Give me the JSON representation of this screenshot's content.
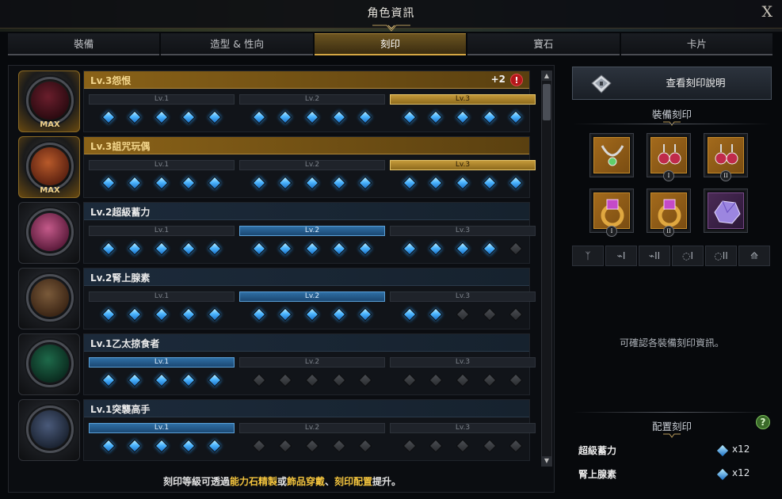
{
  "window": {
    "title": "角色資訊",
    "close_label": "X"
  },
  "tabs": [
    {
      "label": "裝備",
      "active": false
    },
    {
      "label": "造型 & 性向",
      "active": false
    },
    {
      "label": "刻印",
      "active": true
    },
    {
      "label": "寶石",
      "active": false
    },
    {
      "label": "卡片",
      "active": false
    }
  ],
  "engravings": [
    {
      "name": "Lv.3怨恨",
      "max_label": "MAX",
      "highlight": true,
      "plus": "+2",
      "warning": "!",
      "levels": [
        "Lv.1",
        "Lv.2",
        "Lv.3"
      ],
      "active_level": 3,
      "gems": [
        true,
        true,
        true,
        true,
        true,
        true,
        true,
        true,
        true,
        true,
        true,
        true,
        true,
        true,
        true
      ]
    },
    {
      "name": "Lv.3詛咒玩偶",
      "max_label": "MAX",
      "highlight": true,
      "plus": "",
      "warning": "",
      "levels": [
        "Lv.1",
        "Lv.2",
        "Lv.3"
      ],
      "active_level": 3,
      "gems": [
        true,
        true,
        true,
        true,
        true,
        true,
        true,
        true,
        true,
        true,
        true,
        true,
        true,
        true,
        true
      ]
    },
    {
      "name": "Lv.2超級蓄力",
      "max_label": "",
      "highlight": false,
      "plus": "",
      "warning": "",
      "levels": [
        "Lv.1",
        "Lv.2",
        "Lv.3"
      ],
      "active_level": 2,
      "gems": [
        true,
        true,
        true,
        true,
        true,
        true,
        true,
        true,
        true,
        true,
        true,
        true,
        true,
        true,
        false
      ]
    },
    {
      "name": "Lv.2腎上腺素",
      "max_label": "",
      "highlight": false,
      "plus": "",
      "warning": "",
      "levels": [
        "Lv.1",
        "Lv.2",
        "Lv.3"
      ],
      "active_level": 2,
      "gems": [
        true,
        true,
        true,
        true,
        true,
        true,
        true,
        true,
        true,
        true,
        true,
        true,
        false,
        false,
        false
      ]
    },
    {
      "name": "Lv.1乙太掠食者",
      "max_label": "",
      "highlight": false,
      "plus": "",
      "warning": "",
      "levels": [
        "Lv.1",
        "Lv.2",
        "Lv.3"
      ],
      "active_level": 1,
      "gems": [
        true,
        true,
        true,
        true,
        true,
        false,
        false,
        false,
        false,
        false,
        false,
        false,
        false,
        false,
        false
      ]
    },
    {
      "name": "Lv.1突襲高手",
      "max_label": "",
      "highlight": false,
      "plus": "",
      "warning": "",
      "levels": [
        "Lv.1",
        "Lv.2",
        "Lv.3"
      ],
      "active_level": 1,
      "gems": [
        true,
        true,
        true,
        true,
        true,
        false,
        false,
        false,
        false,
        false,
        false,
        false,
        false,
        false,
        false
      ]
    }
  ],
  "hint": {
    "p1": "刻印等級可透過",
    "h1": "能力石精製",
    "p2": "或",
    "h2": "飾品穿戴",
    "p3": "、",
    "h3": "刻印配置",
    "p4": "提升。"
  },
  "right": {
    "view_button": "查看刻印說明",
    "equip_section": "裝備刻印",
    "equipment": [
      {
        "icon": "necklace-icon",
        "roman": ""
      },
      {
        "icon": "earring-icon",
        "roman": "I"
      },
      {
        "icon": "earring-icon",
        "roman": "II"
      },
      {
        "icon": "ring-icon",
        "roman": "I"
      },
      {
        "icon": "ring-icon",
        "roman": "II"
      },
      {
        "icon": "ability-stone-icon",
        "roman": ""
      }
    ],
    "slot_filters": [
      "ᛉ",
      "⌁I",
      "⌁II",
      "◌I",
      "◌II",
      "⟰"
    ],
    "info_text": "可確認各裝備刻印資訊。",
    "config_section": "配置刻印",
    "help": "?",
    "config_items": [
      {
        "name": "超級蓄力",
        "count": "x12"
      },
      {
        "name": "腎上腺素",
        "count": "x12"
      }
    ]
  },
  "colors": {
    "accent_gold": "#d5a744",
    "gem_blue": "#4cb5ff",
    "highlight_text": "#f2c33d"
  }
}
